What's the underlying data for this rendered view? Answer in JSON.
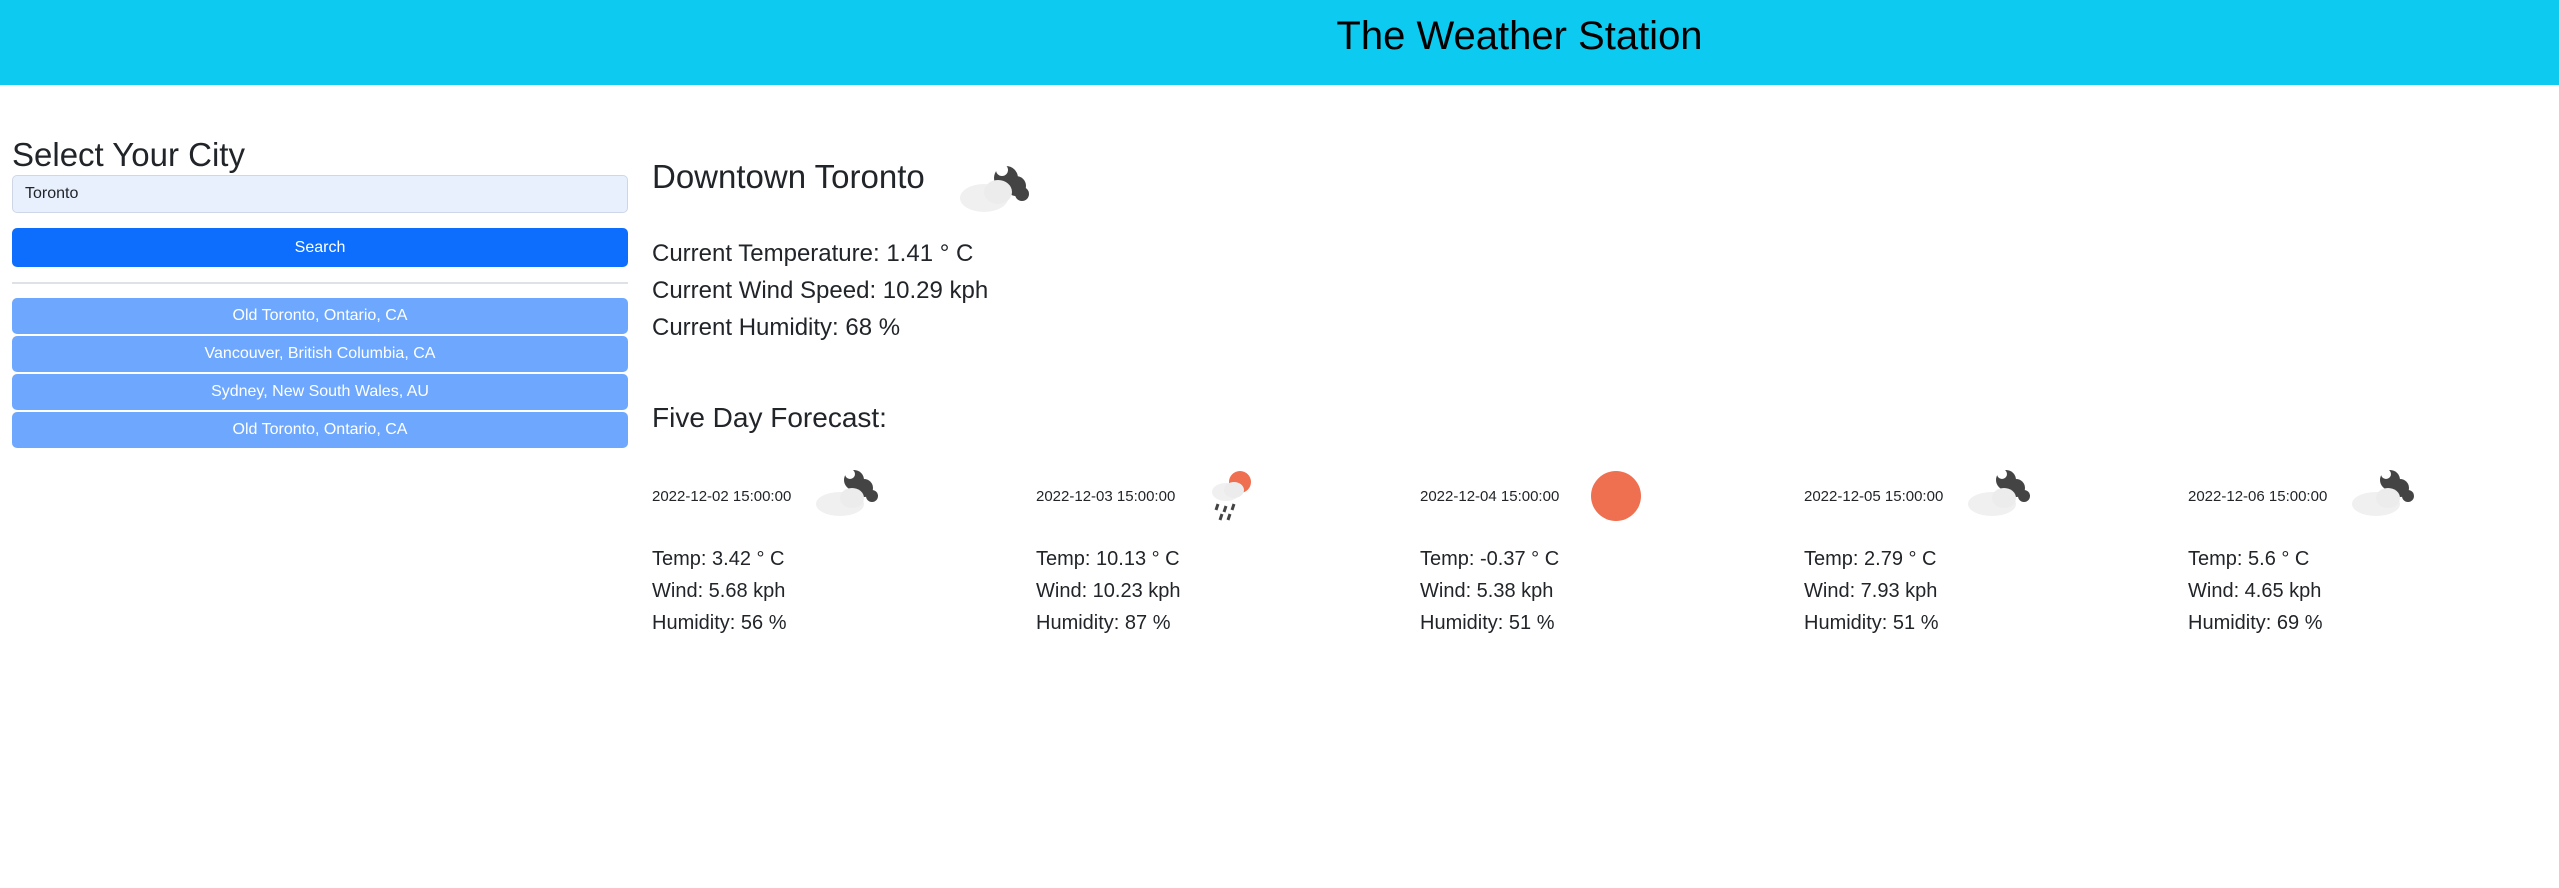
{
  "header": {
    "title": "The Weather Station"
  },
  "sidebar": {
    "title": "Select Your City",
    "search_value": "Toronto",
    "search_button": "Search",
    "history": [
      "Old Toronto, Ontario, CA",
      "Vancouver, British Columbia, CA",
      "Sydney, New South Wales, AU",
      "Old Toronto, Ontario, CA"
    ]
  },
  "current": {
    "city": "Downtown Toronto",
    "icon": "partly-cloudy-night-icon",
    "temperature": "Current Temperature: 1.41 ° C",
    "wind": "Current Wind Speed: 10.29 kph",
    "humidity": "Current Humidity: 68 %"
  },
  "forecast": {
    "title": "Five Day Forecast:",
    "days": [
      {
        "date": "2022-12-02 15:00:00",
        "icon": "partly-cloudy-night-icon",
        "temp": "Temp: 3.42 ° C",
        "wind": "Wind: 5.68 kph",
        "humidity": "Humidity: 56 %"
      },
      {
        "date": "2022-12-03 15:00:00",
        "icon": "rain-sun-icon",
        "temp": "Temp: 10.13 ° C",
        "wind": "Wind: 10.23 kph",
        "humidity": "Humidity: 87 %"
      },
      {
        "date": "2022-12-04 15:00:00",
        "icon": "sun-icon",
        "temp": "Temp: -0.37 ° C",
        "wind": "Wind: 5.38 kph",
        "humidity": "Humidity: 51 %"
      },
      {
        "date": "2022-12-05 15:00:00",
        "icon": "partly-cloudy-night-icon",
        "temp": "Temp: 2.79 ° C",
        "wind": "Wind: 7.93 kph",
        "humidity": "Humidity: 51 %"
      },
      {
        "date": "2022-12-06 15:00:00",
        "icon": "partly-cloudy-night-icon",
        "temp": "Temp: 5.6 ° C",
        "wind": "Wind: 4.65 kph",
        "humidity": "Humidity: 69 %"
      }
    ]
  },
  "colors": {
    "header": "#0dcaf0",
    "search_button": "#0d6efd",
    "history_button": "#6ea8fe",
    "sun": "#ef6f51"
  }
}
